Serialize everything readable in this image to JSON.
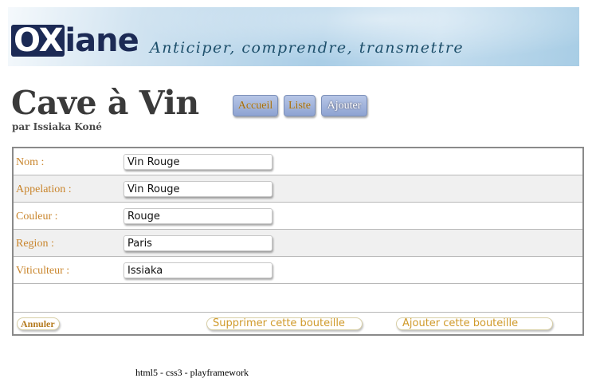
{
  "banner": {
    "logo_highlight": "OX",
    "logo_rest": "iane",
    "tagline": "Anticiper, comprendre, transmettre"
  },
  "header": {
    "title": "Cave à Vin",
    "byline": "par Issiaka Koné"
  },
  "nav": {
    "home": "Accueil",
    "list": "Liste",
    "add": "Ajouter"
  },
  "form": {
    "fields": [
      {
        "label": "Nom :",
        "value": "Vin Rouge"
      },
      {
        "label": "Appelation :",
        "value": "Vin Rouge"
      },
      {
        "label": "Couleur :",
        "value": "Rouge"
      },
      {
        "label": "Region :",
        "value": "Paris"
      },
      {
        "label": "Viticulteur :",
        "value": "Issiaka"
      }
    ],
    "cancel": "Annuler",
    "delete": "Supprimer cette bouteille",
    "submit": "Ajouter cette bouteille"
  },
  "footer": {
    "text": "html5 - css3 - playframework"
  },
  "colors": {
    "label": "#c9852c",
    "button_gold": "#d09a2a",
    "title": "#3a3a3a",
    "logo_navy": "#1c2a55",
    "nav_blue": "#8ea3d2"
  }
}
